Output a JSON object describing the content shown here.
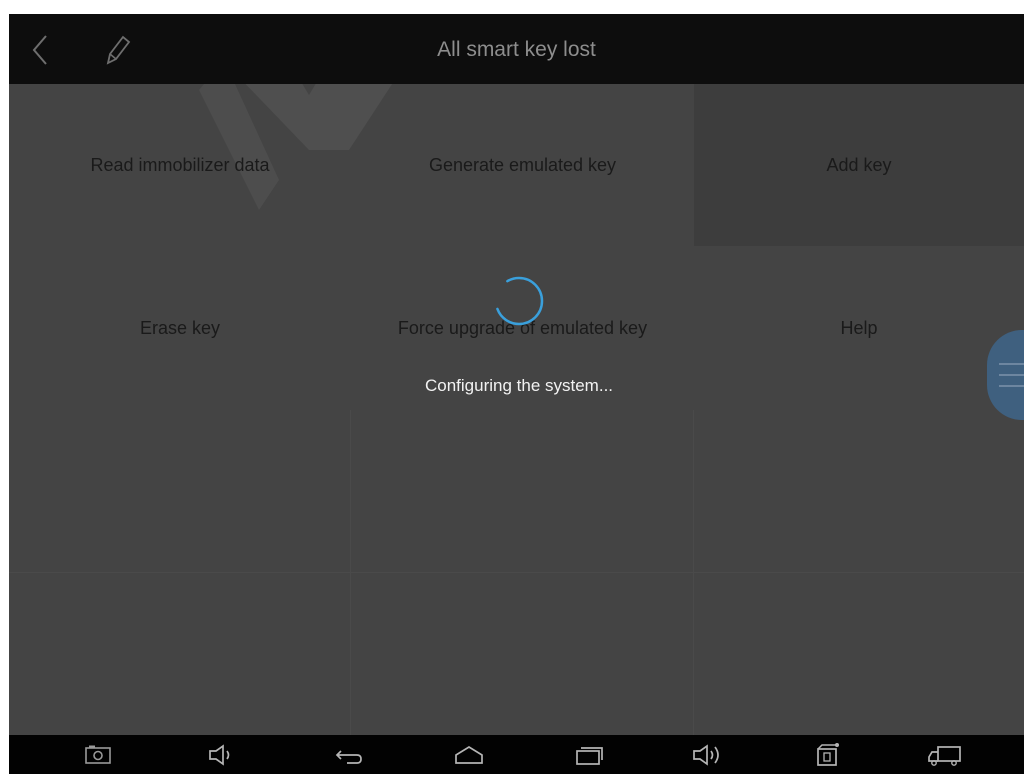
{
  "app": {
    "title": "All smart key lost"
  },
  "menu": {
    "items": [
      {
        "label": "Read immobilizer data"
      },
      {
        "label": "Generate emulated key"
      },
      {
        "label": "Add key"
      },
      {
        "label": "Erase key"
      },
      {
        "label": "Force upgrade of emulated key"
      },
      {
        "label": "Help"
      }
    ]
  },
  "loading": {
    "message": "Configuring the system..."
  },
  "icons": {
    "back": "chevron-left-icon",
    "edit": "pencil-icon",
    "float_menu": "hamburger-menu-icon",
    "nav": [
      "screenshot-icon",
      "volume-down-icon",
      "back-arrow-icon",
      "home-icon",
      "recent-apps-icon",
      "volume-up-icon",
      "vci-device-icon",
      "truck-icon"
    ]
  },
  "colors": {
    "title_bar": "#0d0d0d",
    "content_bg": "#444444",
    "spinner": "#3aa0dc",
    "float_button": "#3f607f",
    "nav_bar": "#020202"
  }
}
